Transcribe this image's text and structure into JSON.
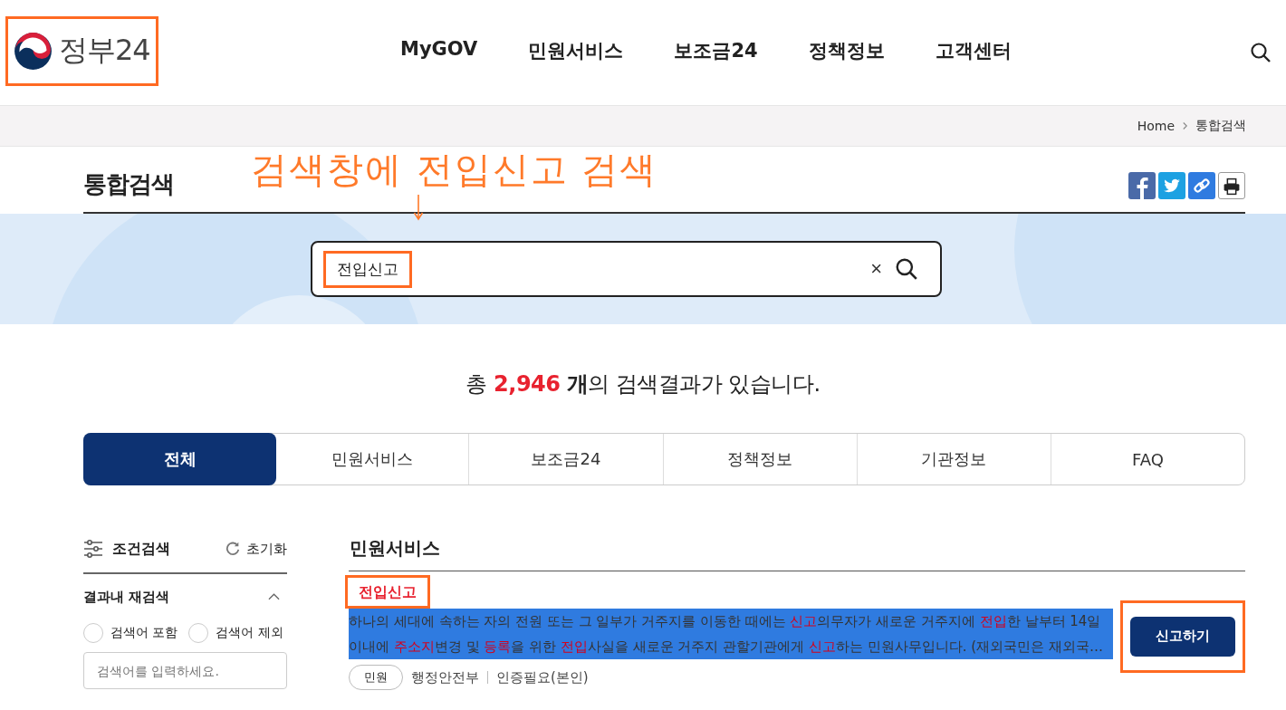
{
  "header": {
    "logo": "정부24",
    "nav": [
      {
        "label": "MyGOV"
      },
      {
        "label": "민원서비스"
      },
      {
        "label": "보조금24"
      },
      {
        "label": "정책정보"
      },
      {
        "label": "고객센터"
      }
    ]
  },
  "breadcrumb": [
    "Home",
    "통합검색"
  ],
  "page_title": "통합검색",
  "annotation": {
    "text": "검색창에 전입신고 검색"
  },
  "search": {
    "value": "전입신고",
    "clear": "×"
  },
  "summary": {
    "prefix": "총",
    "count": "2,946",
    "unit": "개",
    "suffix": "의 검색결과가 있습니다."
  },
  "tabs": [
    {
      "label": "전체",
      "selected": true
    },
    {
      "label": "민원서비스",
      "selected": false
    },
    {
      "label": "보조금24",
      "selected": false
    },
    {
      "label": "정책정보",
      "selected": false
    },
    {
      "label": "기관정보",
      "selected": false
    },
    {
      "label": "FAQ",
      "selected": false
    }
  ],
  "sidebar": {
    "title": "조건검색",
    "reset": "초기화",
    "section": {
      "title": "결과내 재검색",
      "expanded": true,
      "options": [
        {
          "label": "검색어 포함",
          "selected": false
        },
        {
          "label": "검색어 제외",
          "selected": false
        }
      ],
      "placeholder": "검색어를 입력하세요."
    }
  },
  "results": {
    "section_title": "민원서비스",
    "items": [
      {
        "title": "전입신고",
        "lines": [
          [
            {
              "text": "하나의 세대에 속하는 자의 전원 또는 그 일부가 거주지를 이동한 때에는 ",
              "highlight": false
            },
            {
              "text": "신고",
              "highlight": true
            },
            {
              "text": "의무자가 새로운 거주지에 ",
              "highlight": false
            },
            {
              "text": "전입",
              "highlight": true
            },
            {
              "text": "한 날부터 14일",
              "highlight": false
            }
          ],
          [
            {
              "text": "이내에 ",
              "highlight": false
            },
            {
              "text": "주소지",
              "highlight": true
            },
            {
              "text": "변경 및 ",
              "highlight": false
            },
            {
              "text": "등록",
              "highlight": true
            },
            {
              "text": "을 위한 ",
              "highlight": false
            },
            {
              "text": "전입",
              "highlight": true
            },
            {
              "text": "사실을 새로운 거주지 관할기관에게 ",
              "highlight": false
            },
            {
              "text": "신고",
              "highlight": true
            },
            {
              "text": "하는 민원사무입니다. (재외국민은 재외국…",
              "highlight": false
            }
          ]
        ],
        "tag": "민원",
        "agency": "행정안전부",
        "auth": "인증필요(본인)",
        "action": "신고하기"
      }
    ]
  }
}
